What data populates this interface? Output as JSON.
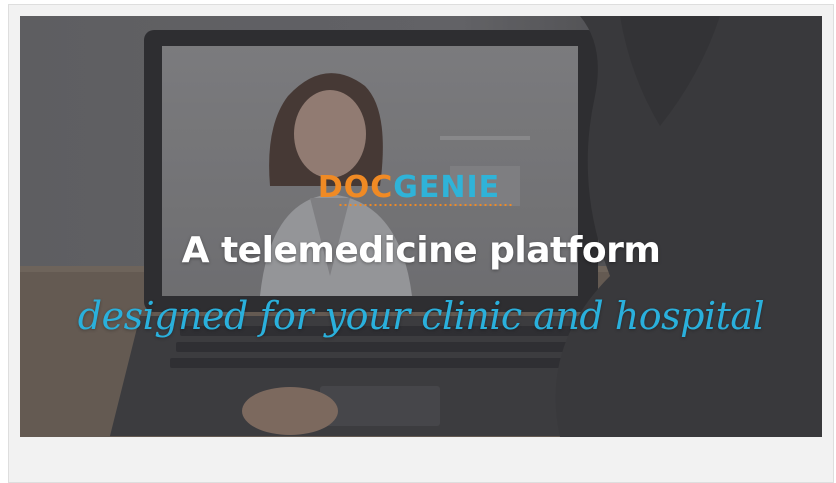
{
  "banner": {
    "logo": {
      "part1": "DOC",
      "part2": "GENIE"
    },
    "headline": "A telemedicine platform",
    "tagline": "designed for your clinic and hospital"
  },
  "colors": {
    "logo_orange": "#f08a24",
    "logo_blue": "#2fb3d8",
    "headline": "#ffffff",
    "tagline": "#2ab0dc",
    "overlay": "#4a4a4c"
  }
}
